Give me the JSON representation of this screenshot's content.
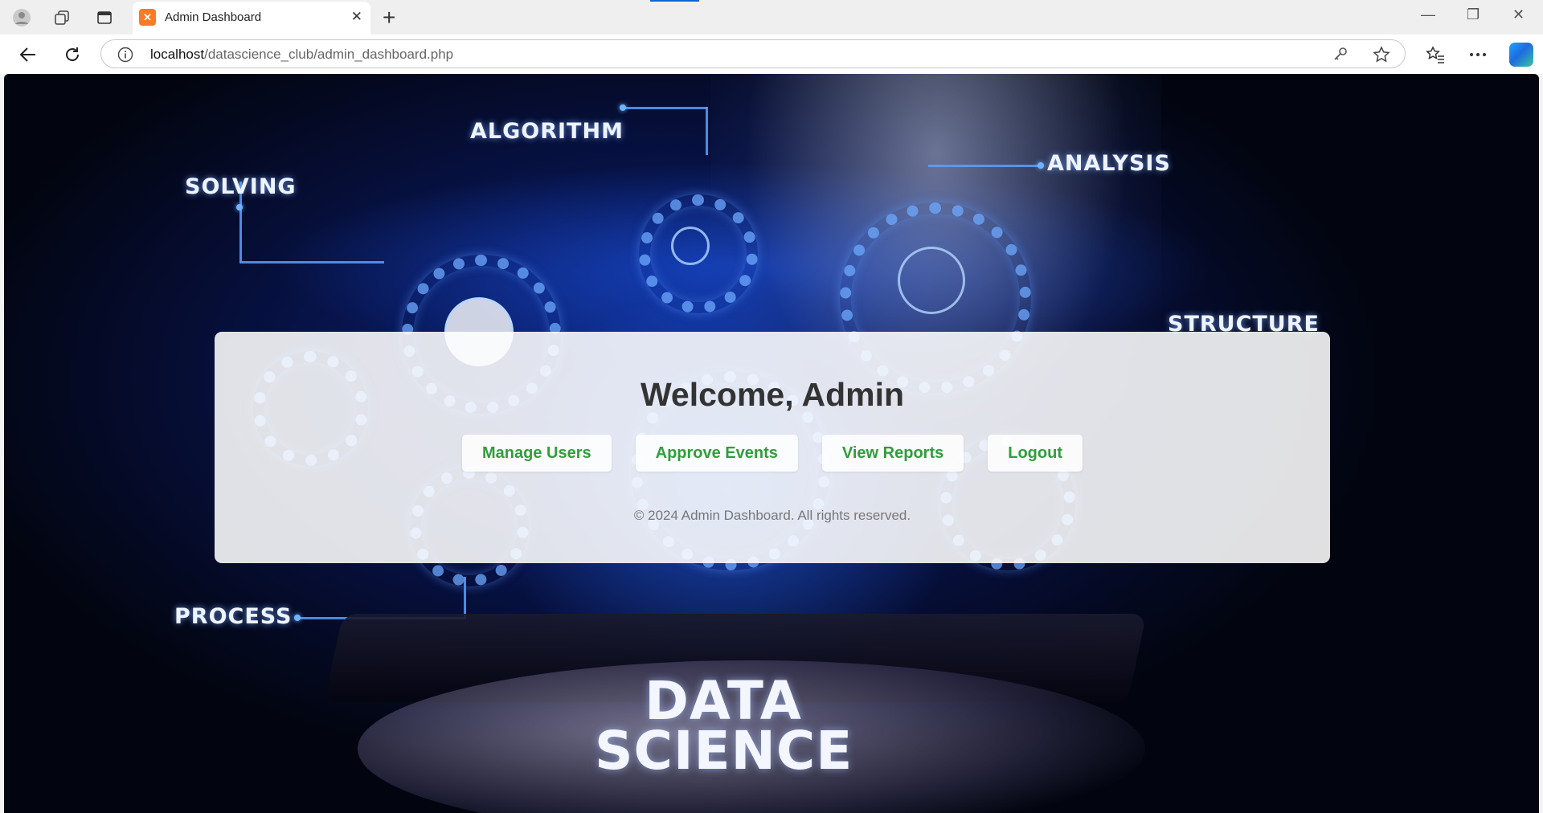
{
  "browser": {
    "tab_title": "Admin Dashboard",
    "tab_favicon": "xampp-icon",
    "url_host": "localhost",
    "url_path": "/datascience_club/admin_dashboard.php"
  },
  "background": {
    "labels": {
      "algorithm": "ALGORITHM",
      "analysis": "ANALYSIS",
      "solving": "SOLVING",
      "structure": "STRUCTURE",
      "process": "PROCESS"
    },
    "title_line1": "DATA",
    "title_line2": "SCIENCE"
  },
  "card": {
    "heading": "Welcome, Admin",
    "actions": {
      "manage_users": "Manage Users",
      "approve_events": "Approve Events",
      "view_reports": "View Reports",
      "logout": "Logout"
    },
    "footer": "© 2024 Admin Dashboard. All rights reserved.",
    "accent_color": "#2f9e3a"
  }
}
